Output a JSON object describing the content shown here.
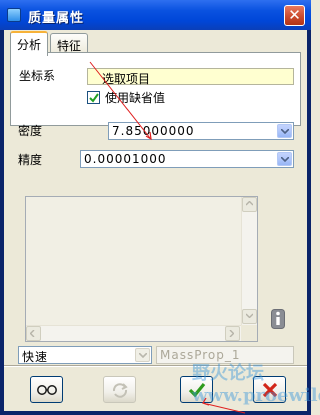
{
  "window": {
    "title": "质量属性",
    "close_symbol": "✕"
  },
  "tabs": [
    {
      "label": "分析",
      "active": true
    },
    {
      "label": "特征",
      "active": false
    }
  ],
  "analysis": {
    "coord_label": "坐标系",
    "coord_value": "选取项目",
    "use_default_label": "使用缺省值",
    "use_default_checked": true,
    "density_label": "密度",
    "density_value": "7.85000000",
    "accuracy_label": "精度",
    "accuracy_value": "0.00001000"
  },
  "bottom": {
    "mode_value": "快速",
    "name_placeholder": "MassProp_1"
  },
  "buttons": [
    {
      "name": "preview-button",
      "icon": "glasses-icon",
      "enabled": true
    },
    {
      "name": "repeat-button",
      "icon": "repeat-icon",
      "enabled": false
    },
    {
      "name": "ok-button",
      "icon": "checkmark-icon",
      "enabled": true
    },
    {
      "name": "cancel-button",
      "icon": "x-icon",
      "enabled": true
    }
  ],
  "watermark": "野火论坛 www.proewildfire.cn",
  "colors": {
    "title_bar": "#0a52e0",
    "coord_field_bg": "#ffffd0",
    "ok_green": "#2e9b1e",
    "cancel_red": "#d2261a",
    "annotation_arrow": "#e02020"
  }
}
